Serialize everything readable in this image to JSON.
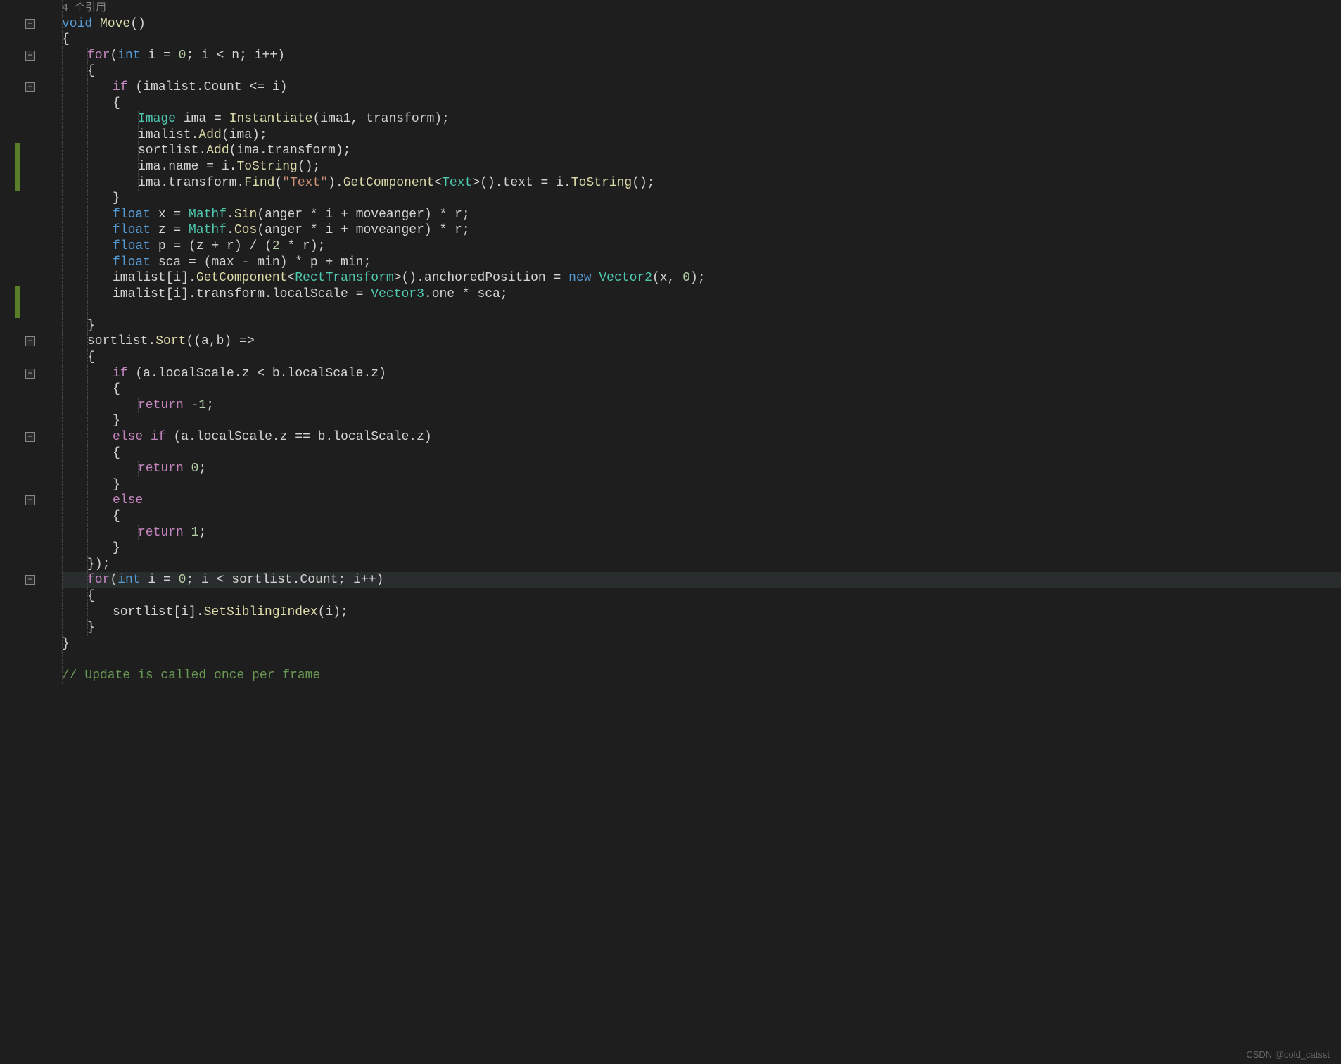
{
  "editor": {
    "codelens": "4 个引用",
    "lines": [
      {
        "indent": 0,
        "fold": null,
        "change": false,
        "tokens": [
          {
            "t": "codelens",
            "v": "4 个引用"
          }
        ]
      },
      {
        "indent": 0,
        "fold": "minus",
        "change": false,
        "tokens": [
          {
            "t": "keyword",
            "v": "void"
          },
          {
            "t": "plain",
            "v": " "
          },
          {
            "t": "method",
            "v": "Move"
          },
          {
            "t": "plain",
            "v": "()"
          }
        ]
      },
      {
        "indent": 0,
        "fold": null,
        "change": false,
        "tokens": [
          {
            "t": "plain",
            "v": "{"
          }
        ]
      },
      {
        "indent": 1,
        "fold": "minus",
        "change": false,
        "tokens": [
          {
            "t": "purple",
            "v": "for"
          },
          {
            "t": "plain",
            "v": "("
          },
          {
            "t": "keyword",
            "v": "int"
          },
          {
            "t": "plain",
            "v": " i = "
          },
          {
            "t": "number",
            "v": "0"
          },
          {
            "t": "plain",
            "v": "; i < n; i++)"
          }
        ]
      },
      {
        "indent": 1,
        "fold": null,
        "change": false,
        "tokens": [
          {
            "t": "plain",
            "v": "{"
          }
        ]
      },
      {
        "indent": 2,
        "fold": "minus",
        "change": false,
        "tokens": [
          {
            "t": "purple",
            "v": "if"
          },
          {
            "t": "plain",
            "v": " (imalist.Count <= i)"
          }
        ]
      },
      {
        "indent": 2,
        "fold": null,
        "change": false,
        "tokens": [
          {
            "t": "plain",
            "v": "{"
          }
        ]
      },
      {
        "indent": 3,
        "fold": null,
        "change": false,
        "tokens": [
          {
            "t": "type",
            "v": "Image"
          },
          {
            "t": "plain",
            "v": " ima = "
          },
          {
            "t": "method",
            "v": "Instantiate"
          },
          {
            "t": "plain",
            "v": "(ima1, transform);"
          }
        ]
      },
      {
        "indent": 3,
        "fold": null,
        "change": false,
        "tokens": [
          {
            "t": "plain",
            "v": "imalist."
          },
          {
            "t": "method",
            "v": "Add"
          },
          {
            "t": "plain",
            "v": "(ima);"
          }
        ]
      },
      {
        "indent": 3,
        "fold": null,
        "change": true,
        "tokens": [
          {
            "t": "plain",
            "v": "sortlist."
          },
          {
            "t": "method",
            "v": "Add"
          },
          {
            "t": "plain",
            "v": "(ima.transform);"
          }
        ]
      },
      {
        "indent": 3,
        "fold": null,
        "change": true,
        "tokens": [
          {
            "t": "plain",
            "v": "ima.name = i."
          },
          {
            "t": "method",
            "v": "ToString"
          },
          {
            "t": "plain",
            "v": "();"
          }
        ]
      },
      {
        "indent": 3,
        "fold": null,
        "change": true,
        "tokens": [
          {
            "t": "plain",
            "v": "ima.transform."
          },
          {
            "t": "method",
            "v": "Find"
          },
          {
            "t": "plain",
            "v": "("
          },
          {
            "t": "string",
            "v": "\"Text\""
          },
          {
            "t": "plain",
            "v": ")."
          },
          {
            "t": "method",
            "v": "GetComponent"
          },
          {
            "t": "plain",
            "v": "<"
          },
          {
            "t": "type",
            "v": "Text"
          },
          {
            "t": "plain",
            "v": ">().text = i."
          },
          {
            "t": "method",
            "v": "ToString"
          },
          {
            "t": "plain",
            "v": "();"
          }
        ]
      },
      {
        "indent": 2,
        "fold": null,
        "change": false,
        "tokens": [
          {
            "t": "plain",
            "v": "}"
          }
        ]
      },
      {
        "indent": 2,
        "fold": null,
        "change": false,
        "tokens": [
          {
            "t": "keyword",
            "v": "float"
          },
          {
            "t": "plain",
            "v": " x = "
          },
          {
            "t": "type",
            "v": "Mathf"
          },
          {
            "t": "plain",
            "v": "."
          },
          {
            "t": "method",
            "v": "Sin"
          },
          {
            "t": "plain",
            "v": "(anger * i + moveanger) * r;"
          }
        ]
      },
      {
        "indent": 2,
        "fold": null,
        "change": false,
        "tokens": [
          {
            "t": "keyword",
            "v": "float"
          },
          {
            "t": "plain",
            "v": " z = "
          },
          {
            "t": "type",
            "v": "Mathf"
          },
          {
            "t": "plain",
            "v": "."
          },
          {
            "t": "method",
            "v": "Cos"
          },
          {
            "t": "plain",
            "v": "(anger * i + moveanger) * r;"
          }
        ]
      },
      {
        "indent": 2,
        "fold": null,
        "change": false,
        "tokens": [
          {
            "t": "keyword",
            "v": "float"
          },
          {
            "t": "plain",
            "v": " p = (z + r) / ("
          },
          {
            "t": "number",
            "v": "2"
          },
          {
            "t": "plain",
            "v": " * r);"
          }
        ]
      },
      {
        "indent": 2,
        "fold": null,
        "change": false,
        "tokens": [
          {
            "t": "keyword",
            "v": "float"
          },
          {
            "t": "plain",
            "v": " sca = (max - min) * p + min;"
          }
        ]
      },
      {
        "indent": 2,
        "fold": null,
        "change": false,
        "tokens": [
          {
            "t": "plain",
            "v": "imalist[i]."
          },
          {
            "t": "method",
            "v": "GetComponent"
          },
          {
            "t": "plain",
            "v": "<"
          },
          {
            "t": "type",
            "v": "RectTransform"
          },
          {
            "t": "plain",
            "v": ">().anchoredPosition = "
          },
          {
            "t": "keyword",
            "v": "new"
          },
          {
            "t": "plain",
            "v": " "
          },
          {
            "t": "type",
            "v": "Vector2"
          },
          {
            "t": "plain",
            "v": "(x, "
          },
          {
            "t": "number",
            "v": "0"
          },
          {
            "t": "plain",
            "v": ");"
          }
        ]
      },
      {
        "indent": 2,
        "fold": null,
        "change": true,
        "tokens": [
          {
            "t": "plain",
            "v": "imalist[i].transform.localScale = "
          },
          {
            "t": "type",
            "v": "Vector3"
          },
          {
            "t": "plain",
            "v": ".one * sca;"
          }
        ]
      },
      {
        "indent": 2,
        "fold": null,
        "change": true,
        "tokens": []
      },
      {
        "indent": 1,
        "fold": null,
        "change": false,
        "tokens": [
          {
            "t": "plain",
            "v": "}"
          }
        ]
      },
      {
        "indent": 1,
        "fold": "minus",
        "change": false,
        "tokens": [
          {
            "t": "plain",
            "v": "sortlist."
          },
          {
            "t": "method",
            "v": "Sort"
          },
          {
            "t": "plain",
            "v": "((a,b) =>"
          }
        ]
      },
      {
        "indent": 1,
        "fold": null,
        "change": false,
        "tokens": [
          {
            "t": "plain",
            "v": "{"
          }
        ]
      },
      {
        "indent": 2,
        "fold": "minus",
        "change": false,
        "tokens": [
          {
            "t": "purple",
            "v": "if"
          },
          {
            "t": "plain",
            "v": " (a.localScale.z < b.localScale.z)"
          }
        ]
      },
      {
        "indent": 2,
        "fold": null,
        "change": false,
        "tokens": [
          {
            "t": "plain",
            "v": "{"
          }
        ]
      },
      {
        "indent": 3,
        "fold": null,
        "change": false,
        "tokens": [
          {
            "t": "purple",
            "v": "return"
          },
          {
            "t": "plain",
            "v": " -"
          },
          {
            "t": "number",
            "v": "1"
          },
          {
            "t": "plain",
            "v": ";"
          }
        ]
      },
      {
        "indent": 2,
        "fold": null,
        "change": false,
        "tokens": [
          {
            "t": "plain",
            "v": "}"
          }
        ]
      },
      {
        "indent": 2,
        "fold": "minus",
        "change": false,
        "tokens": [
          {
            "t": "purple",
            "v": "else"
          },
          {
            "t": "plain",
            "v": " "
          },
          {
            "t": "purple",
            "v": "if"
          },
          {
            "t": "plain",
            "v": " (a.localScale.z == b.localScale.z)"
          }
        ]
      },
      {
        "indent": 2,
        "fold": null,
        "change": false,
        "tokens": [
          {
            "t": "plain",
            "v": "{"
          }
        ]
      },
      {
        "indent": 3,
        "fold": null,
        "change": false,
        "tokens": [
          {
            "t": "purple",
            "v": "return"
          },
          {
            "t": "plain",
            "v": " "
          },
          {
            "t": "number",
            "v": "0"
          },
          {
            "t": "plain",
            "v": ";"
          }
        ]
      },
      {
        "indent": 2,
        "fold": null,
        "change": false,
        "tokens": [
          {
            "t": "plain",
            "v": "}"
          }
        ]
      },
      {
        "indent": 2,
        "fold": "minus",
        "change": false,
        "tokens": [
          {
            "t": "purple",
            "v": "else"
          }
        ]
      },
      {
        "indent": 2,
        "fold": null,
        "change": false,
        "tokens": [
          {
            "t": "plain",
            "v": "{"
          }
        ]
      },
      {
        "indent": 3,
        "fold": null,
        "change": false,
        "tokens": [
          {
            "t": "purple",
            "v": "return"
          },
          {
            "t": "plain",
            "v": " "
          },
          {
            "t": "number",
            "v": "1"
          },
          {
            "t": "plain",
            "v": ";"
          }
        ]
      },
      {
        "indent": 2,
        "fold": null,
        "change": false,
        "tokens": [
          {
            "t": "plain",
            "v": "}"
          }
        ]
      },
      {
        "indent": 1,
        "fold": null,
        "change": false,
        "tokens": [
          {
            "t": "plain",
            "v": "});"
          }
        ]
      },
      {
        "indent": 1,
        "fold": "minus",
        "change": false,
        "highlight": true,
        "tokens": [
          {
            "t": "purple",
            "v": "for"
          },
          {
            "t": "plain",
            "v": "("
          },
          {
            "t": "keyword",
            "v": "int"
          },
          {
            "t": "plain",
            "v": " i = "
          },
          {
            "t": "number",
            "v": "0"
          },
          {
            "t": "plain",
            "v": "; i < sortlist.Count; i++)"
          }
        ]
      },
      {
        "indent": 1,
        "fold": null,
        "change": false,
        "tokens": [
          {
            "t": "plain",
            "v": "{"
          }
        ]
      },
      {
        "indent": 2,
        "fold": null,
        "change": false,
        "tokens": [
          {
            "t": "plain",
            "v": "sortlist[i]."
          },
          {
            "t": "method",
            "v": "SetSiblingIndex"
          },
          {
            "t": "plain",
            "v": "(i);"
          }
        ]
      },
      {
        "indent": 1,
        "fold": null,
        "change": false,
        "tokens": [
          {
            "t": "plain",
            "v": "}"
          }
        ]
      },
      {
        "indent": 0,
        "fold": null,
        "change": false,
        "tokens": [
          {
            "t": "plain",
            "v": "}"
          }
        ]
      },
      {
        "indent": 0,
        "fold": null,
        "change": false,
        "tokens": []
      },
      {
        "indent": 0,
        "fold": null,
        "change": false,
        "tokens": [
          {
            "t": "comment",
            "v": "// Update is called once per frame"
          }
        ]
      }
    ]
  },
  "watermark": "CSDN @cold_catsst"
}
